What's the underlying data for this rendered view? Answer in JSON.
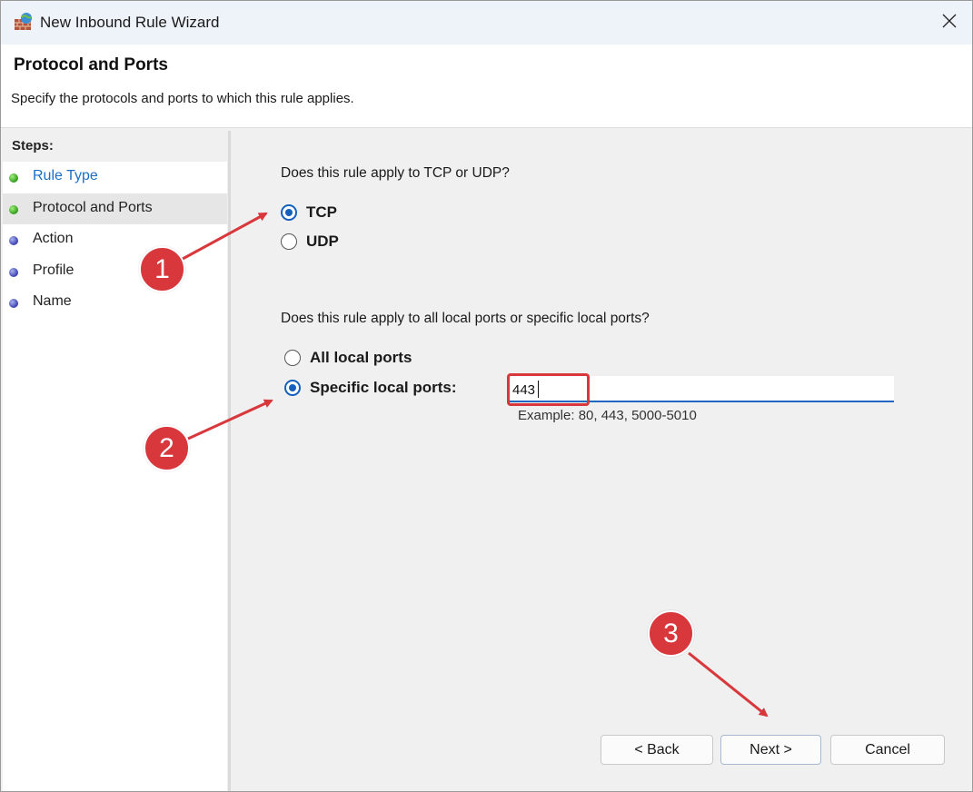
{
  "window": {
    "title": "New Inbound Rule Wizard",
    "close_glyph": "✕"
  },
  "header": {
    "title": "Protocol and Ports",
    "subtitle": "Specify the protocols and ports to which this rule applies."
  },
  "steps": {
    "heading": "Steps:",
    "items": [
      {
        "label": "Rule Type",
        "dot": "green",
        "state": "link"
      },
      {
        "label": "Protocol and Ports",
        "dot": "green",
        "state": "selected"
      },
      {
        "label": "Action",
        "dot": "blue",
        "state": "pending"
      },
      {
        "label": "Profile",
        "dot": "blue",
        "state": "pending"
      },
      {
        "label": "Name",
        "dot": "blue",
        "state": "pending"
      }
    ]
  },
  "protocol": {
    "question": "Does this rule apply to TCP or UDP?",
    "options": [
      {
        "label": "TCP",
        "checked": true
      },
      {
        "label": "UDP",
        "checked": false
      }
    ]
  },
  "ports": {
    "question": "Does this rule apply to all local ports or specific local ports?",
    "options": [
      {
        "label": "All local ports",
        "checked": false
      },
      {
        "label": "Specific local ports:",
        "checked": true
      }
    ],
    "value": "443",
    "example": "Example: 80, 443, 5000-5010"
  },
  "buttons": {
    "back": "< Back",
    "next": "Next >",
    "cancel": "Cancel"
  },
  "annotations": {
    "badges": [
      "1",
      "2",
      "3"
    ],
    "color": "#d8373c"
  }
}
